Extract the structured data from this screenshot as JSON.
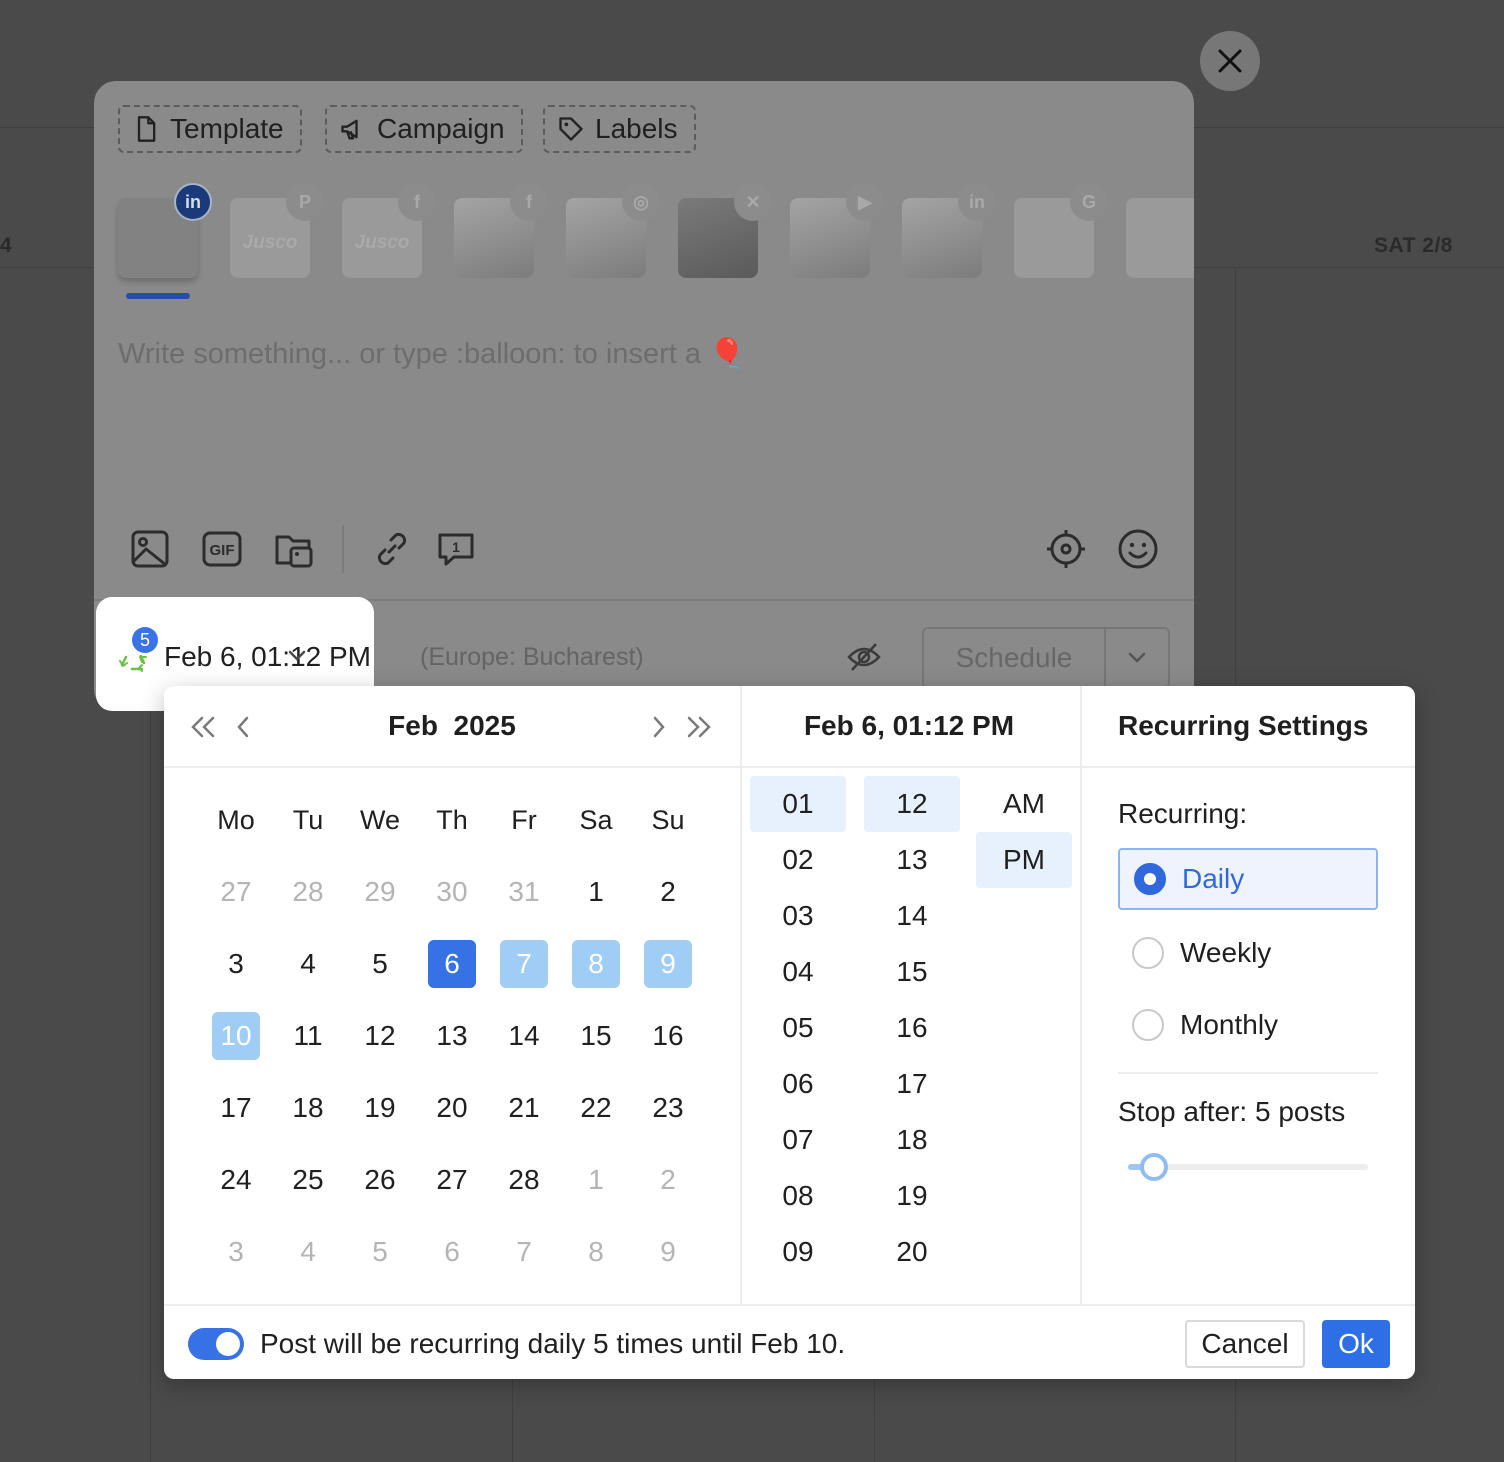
{
  "background": {
    "day_left": "4",
    "day_right": "SAT 2/8"
  },
  "composer": {
    "tags": {
      "template": "Template",
      "campaign": "Campaign",
      "labels": "Labels"
    },
    "accounts": [
      {
        "network": "linkedin-icon",
        "badge": "in",
        "active": true
      },
      {
        "network": "pinterest-icon",
        "badge": "P",
        "text": "Jusco"
      },
      {
        "network": "facebook-icon",
        "badge": "f",
        "text": "Jusco"
      },
      {
        "network": "facebook-icon",
        "badge": "f",
        "photo": true
      },
      {
        "network": "instagram-icon",
        "badge": "◎",
        "photo": true
      },
      {
        "network": "x-icon",
        "badge": "✕",
        "photo": "dark"
      },
      {
        "network": "youtube-icon",
        "badge": "▶",
        "photo": true
      },
      {
        "network": "linkedin-icon",
        "badge": "in",
        "photo": true
      },
      {
        "network": "google-icon",
        "badge": "G"
      }
    ],
    "editor_placeholder": "Write something... or type :balloon: to insert a 🎈",
    "timezone": "(Europe: Bucharest)",
    "schedule_label": "Schedule"
  },
  "date_chip": {
    "badge_count": "5",
    "date": "Feb 6, 01:12 PM"
  },
  "picker": {
    "month_year": "Feb  2025",
    "time_title": "Feb 6, 01:12 PM",
    "recurring_title": "Recurring Settings",
    "weekdays": [
      "Mo",
      "Tu",
      "We",
      "Th",
      "Fr",
      "Sa",
      "Su"
    ],
    "days": [
      {
        "n": "27",
        "s": "muted"
      },
      {
        "n": "28",
        "s": "muted"
      },
      {
        "n": "29",
        "s": "muted"
      },
      {
        "n": "30",
        "s": "muted"
      },
      {
        "n": "31",
        "s": "muted"
      },
      {
        "n": "1"
      },
      {
        "n": "2"
      },
      {
        "n": "3"
      },
      {
        "n": "4"
      },
      {
        "n": "5"
      },
      {
        "n": "6",
        "s": "sel"
      },
      {
        "n": "7",
        "s": "range"
      },
      {
        "n": "8",
        "s": "range"
      },
      {
        "n": "9",
        "s": "range"
      },
      {
        "n": "10",
        "s": "range"
      },
      {
        "n": "11"
      },
      {
        "n": "12"
      },
      {
        "n": "13"
      },
      {
        "n": "14"
      },
      {
        "n": "15"
      },
      {
        "n": "16"
      },
      {
        "n": "17"
      },
      {
        "n": "18"
      },
      {
        "n": "19"
      },
      {
        "n": "20"
      },
      {
        "n": "21"
      },
      {
        "n": "22"
      },
      {
        "n": "23"
      },
      {
        "n": "24"
      },
      {
        "n": "25"
      },
      {
        "n": "26"
      },
      {
        "n": "27"
      },
      {
        "n": "28"
      },
      {
        "n": "1",
        "s": "muted"
      },
      {
        "n": "2",
        "s": "muted"
      },
      {
        "n": "3",
        "s": "muted"
      },
      {
        "n": "4",
        "s": "muted"
      },
      {
        "n": "5",
        "s": "muted"
      },
      {
        "n": "6",
        "s": "muted"
      },
      {
        "n": "7",
        "s": "muted"
      },
      {
        "n": "8",
        "s": "muted"
      },
      {
        "n": "9",
        "s": "muted"
      }
    ],
    "hours": [
      "01",
      "02",
      "03",
      "04",
      "05",
      "06",
      "07",
      "08",
      "09"
    ],
    "selected_hour": "01",
    "minutes": [
      "12",
      "13",
      "14",
      "15",
      "16",
      "17",
      "18",
      "19",
      "20"
    ],
    "selected_minute": "12",
    "meridiem": [
      "AM",
      "PM"
    ],
    "selected_meridiem": "PM",
    "recurring_label": "Recurring:",
    "options": [
      "Daily",
      "Weekly",
      "Monthly"
    ],
    "selected_option": "Daily",
    "stop_after_label": "Stop after: 5 posts",
    "stop_after_value": 5,
    "stop_after_fraction": 0.11,
    "footer_text": "Post will be recurring daily 5 times until Feb 10.",
    "recurring_enabled": true,
    "cancel_label": "Cancel",
    "ok_label": "Ok"
  }
}
